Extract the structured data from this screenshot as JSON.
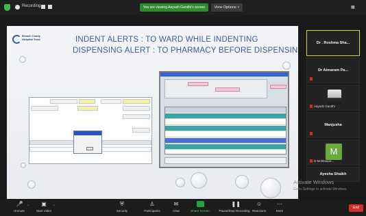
{
  "topbar": {
    "recording_label": "Recording...",
    "share_banner": "You are viewing Aayush Gandhi's screen",
    "view_options": "View Options ˅"
  },
  "slide": {
    "logo_text": "Breach Candy Hospital Trust",
    "title_line1": "INDENT ALERTS : TO WARD WHILE INDENTING",
    "title_line2": "DISPENSING  ALERT :  TO PHARMACY BEFORE DISPENSING"
  },
  "gallery": [
    {
      "name": "Dr . Roshma Sha...",
      "active": true,
      "type": "name"
    },
    {
      "name": "Dr Atmaram Pa...",
      "type": "name"
    },
    {
      "name": "Aayush Gandhi",
      "type": "photo"
    },
    {
      "name": "Manjusha",
      "type": "name"
    },
    {
      "name": "D Mohitaqua...",
      "type": "avatar",
      "letter": "M",
      "avatar_color": "#6aaa3c"
    },
    {
      "name": "Ayesha Shaikh",
      "type": "name"
    }
  ],
  "activate": {
    "line1": "Activate Windows",
    "line2": "Go to Settings to activate Windows"
  },
  "toolbar": {
    "unmute": "Unmute",
    "start_video": "Start Video",
    "security": "Security",
    "participants": "Participants",
    "participants_count": "21",
    "chat": "Chat",
    "share_screen": "Share Screen",
    "pause_recording": "Pause/Stop Recording",
    "reactions": "Reactions",
    "more": "More",
    "end": "End"
  },
  "colors": {
    "share_green": "#2e8b2e",
    "active_border": "#d6d928",
    "end_red": "#d2302b",
    "title_blue": "#3a5ba0"
  }
}
